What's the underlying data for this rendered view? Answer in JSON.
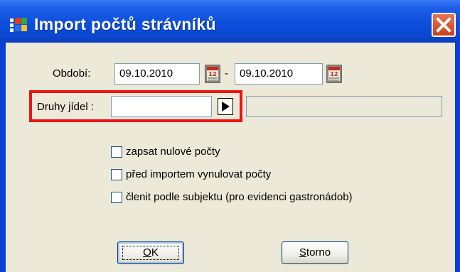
{
  "window": {
    "title": "Import počtů strávníků"
  },
  "form": {
    "period_label": "Období:",
    "date_from": "09.10.2010",
    "date_separator": "-",
    "date_to": "09.10.2010",
    "meal_types_label": "Druhy jídel :",
    "meal_types_value": "",
    "meal_types_description": ""
  },
  "checkboxes": [
    {
      "label": "zapsat nulové počty",
      "checked": false
    },
    {
      "label": "před importem vynulovat počty",
      "checked": false
    },
    {
      "label": "členit podle subjektu (pro evidenci gastronádob)",
      "checked": false
    }
  ],
  "buttons": {
    "ok_mnemonic": "O",
    "ok_rest": "K",
    "cancel_mnemonic": "S",
    "cancel_rest": "torno"
  },
  "icons": {
    "app": "windows-app-icon",
    "close": "close-icon",
    "calendar": "calendar-icon",
    "browse": "play-arrow-icon"
  },
  "colors": {
    "titlebar": "#0a47cf",
    "dialog_background": "#ece9d8",
    "highlight_border": "#ee1414",
    "close_button": "#d2542c"
  }
}
